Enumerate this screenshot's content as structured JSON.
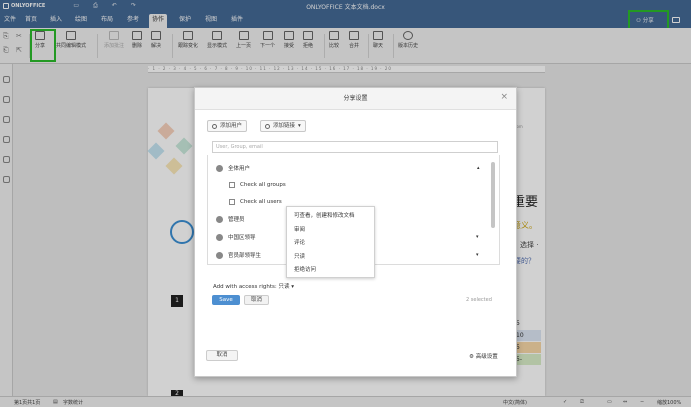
{
  "app": {
    "brand": "ONLYOFFICE",
    "doc_title": "ONLYOFFICE 文本文档.docx"
  },
  "menu": {
    "tabs": [
      {
        "label": "文件"
      },
      {
        "label": "首页"
      },
      {
        "label": "插入"
      },
      {
        "label": "绘图"
      },
      {
        "label": "布局"
      },
      {
        "label": "参考"
      },
      {
        "label": "协作"
      },
      {
        "label": "保护"
      },
      {
        "label": "视图"
      },
      {
        "label": "插件"
      }
    ],
    "active_tab": "协作",
    "share_label": "分享"
  },
  "toolbar": {
    "buttons": [
      {
        "label": "分享"
      },
      {
        "label": "共同编辑模式"
      },
      {
        "label": "添加批注"
      },
      {
        "label": "删除"
      },
      {
        "label": "解决"
      },
      {
        "label": "跟踪变化"
      },
      {
        "label": "显示模式"
      },
      {
        "label": "上一页"
      },
      {
        "label": "下一个"
      },
      {
        "label": "接受"
      },
      {
        "label": "拒绝"
      },
      {
        "label": "比较"
      },
      {
        "label": "合并"
      },
      {
        "label": "聊天"
      },
      {
        "label": "版本历史"
      }
    ]
  },
  "ruler_text": "· 1 · 2 · 3 · 4 · 5 · 6 · 7 · 8 · 9 · 10 · 11 · 12 · 13 · 14 · 15 · 16 · 17 · 18 · 19 · 20",
  "document": {
    "heading": "重要",
    "subheading": "意义。",
    "line3": "选择 ·",
    "line4": "要的？",
    "email": ".com",
    "page_number": "1",
    "page_number2": "2",
    "table_values": [
      "5",
      "10",
      "5",
      "5-"
    ]
  },
  "dialog": {
    "title": "分享设置",
    "add_users": "添加用户",
    "add_link": "添加链接",
    "search_placeholder": "User, Group, email",
    "rows": [
      {
        "label": "全体用户"
      },
      {
        "label": "Check all groups"
      },
      {
        "label": "Check all users"
      },
      {
        "label": "管理员"
      },
      {
        "label": "中国区领导"
      },
      {
        "label": "官员部领导生"
      }
    ],
    "permissions": [
      "可查看，创建和修改文档",
      "审阅",
      "评论",
      "只读",
      "拒绝访问"
    ],
    "access_label": "Add with access rights:",
    "access_value": "只读",
    "save": "Save",
    "cancel": "取消",
    "selected": "2 selected",
    "back": "取消",
    "advanced": "高级设置"
  },
  "status": {
    "page": "第1页共1页",
    "wordcount": "字数统计",
    "language": "中文(简体)",
    "zoom": "缩放100%"
  }
}
